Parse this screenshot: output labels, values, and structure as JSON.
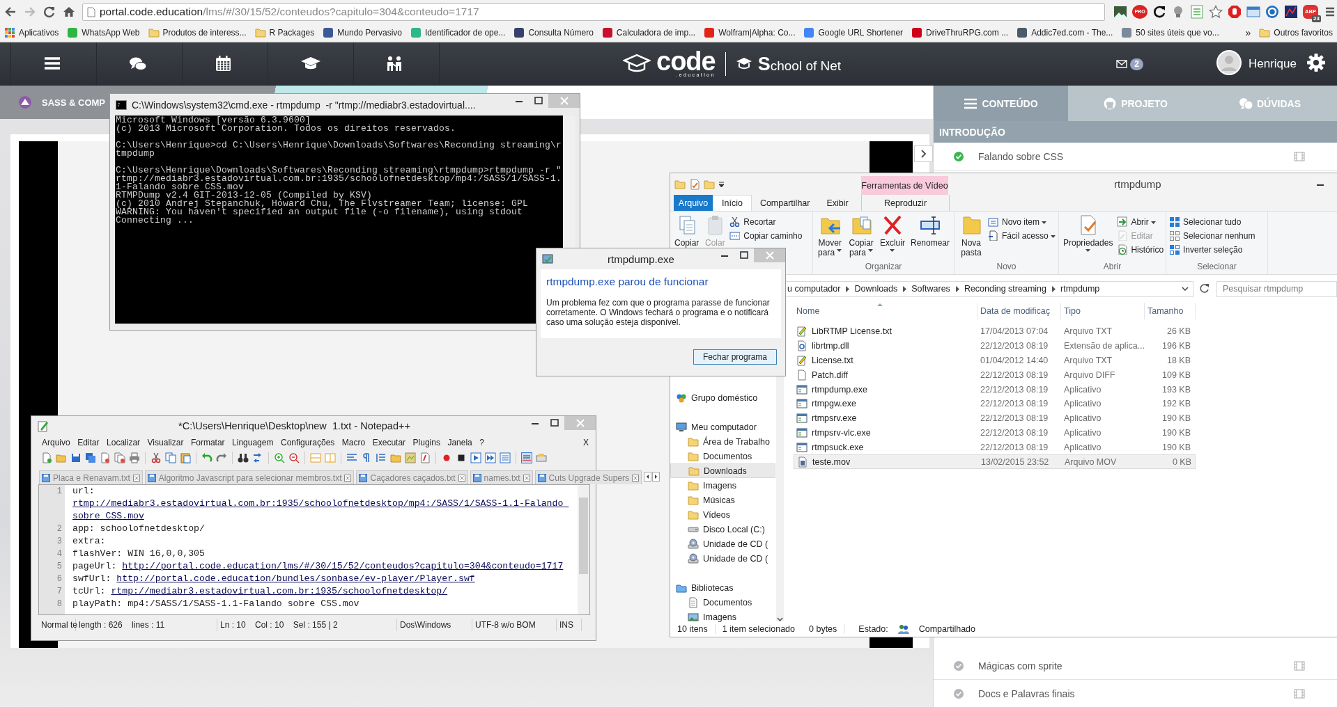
{
  "browser": {
    "url_host": "portal.code.education",
    "url_path": "/lms/#/30/15/52/conteudos?capitulo=304&conteudo=1717",
    "extensions": [
      {
        "kind": "photo"
      },
      {
        "kind": "pro",
        "label": "PRO"
      },
      {
        "kind": "reload"
      },
      {
        "kind": "bulb"
      },
      {
        "kind": "list"
      },
      {
        "kind": "star"
      },
      {
        "kind": "stop"
      },
      {
        "kind": "window"
      },
      {
        "kind": "ring"
      },
      {
        "kind": "chart"
      },
      {
        "kind": "abp",
        "label": "ABP",
        "count": "23"
      },
      {
        "kind": "menu"
      }
    ],
    "bookmarks": [
      {
        "kind": "apps",
        "label": "Aplicativos"
      },
      {
        "kind": "site",
        "color": "#2fb544",
        "label": "WhatsApp Web"
      },
      {
        "kind": "folder",
        "label": "Produtos de interess..."
      },
      {
        "kind": "folder",
        "label": "R Packages"
      },
      {
        "kind": "site",
        "color": "#3b5998",
        "label": "Mundo Pervasivo"
      },
      {
        "kind": "site",
        "color": "#2eb88a",
        "label": "Identificador de ope..."
      },
      {
        "kind": "site",
        "color": "#35406b",
        "label": "Consulta Número"
      },
      {
        "kind": "site",
        "color": "#c8102e",
        "label": "Calculadora de imp..."
      },
      {
        "kind": "site",
        "color": "#e2231a",
        "label": "Wolfram|Alpha: Co..."
      },
      {
        "kind": "site",
        "color": "#4285f4",
        "label": "Google URL Shortener"
      },
      {
        "kind": "site",
        "color": "#d0021b",
        "label": "DriveThruRPG.com ..."
      },
      {
        "kind": "site",
        "color": "#4a5a6a",
        "label": "Addic7ed.com - The..."
      },
      {
        "kind": "site",
        "color": "#7a8a9a",
        "label": "50 sites úteis que vo..."
      }
    ],
    "more": "»",
    "other_bookmarks": "Outros favoritos"
  },
  "site": {
    "logo": "code",
    "logo_tagline": ".education",
    "partner": "School of Net",
    "messages": "2",
    "user": "Henrique",
    "course": "SASS & COMP",
    "tabs": [
      {
        "label": "CONTEÚDO",
        "selected": true
      },
      {
        "label": "PROJETO",
        "selected": false
      },
      {
        "label": "DÚVIDAS",
        "selected": false
      }
    ],
    "section": "INTRODUÇÃO",
    "lessons_top": [
      {
        "title": "Falando sobre CSS",
        "completed": true
      }
    ],
    "lessons_bottom": [
      {
        "title": "Mágicas com sprite",
        "completed": false
      },
      {
        "title": "Docs e Palavras finais",
        "completed": false
      }
    ]
  },
  "cmd": {
    "title": "C:\\Windows\\system32\\cmd.exe - rtmpdump  -r \"rtmp://mediabr3.estadovirtual....",
    "blocks": [
      [
        "Microsoft Windows [versão 6.3.9600]",
        "(c) 2013 Microsoft Corporation. Todos os direitos reservados."
      ],
      [
        "C:\\Users\\Henrique>cd C:\\Users\\Henrique\\Downloads\\Softwares\\Reconding streaming\\r",
        "tmpdump"
      ],
      [
        "C:\\Users\\Henrique\\Downloads\\Softwares\\Reconding streaming\\rtmpdump>rtmpdump -r \"",
        "rtmp://mediabr3.estadovirtual.com.br:1935/schoolofnetdesktop/mp4:/SASS/1/SASS-1.",
        "1-Falando sobre CSS.mov",
        "RTMPDump v2.4 GIT-2013-12-05 (Compiled by KSV)",
        "(c) 2010 Andrej Stepanchuk, Howard Chu, The Flvstreamer Team; license: GPL",
        "WARNING: You haven't specified an output file (-o filename), using stdout",
        "Connecting ..."
      ]
    ]
  },
  "dialog": {
    "title": "rtmpdump.exe",
    "heading": "rtmpdump.exe parou de funcionar",
    "message": "Um problema fez com que o programa parasse de funcionar corretamente. O Windows fechará o programa e o notificará caso uma solução esteja disponível.",
    "button": "Fechar programa"
  },
  "explorer": {
    "title": "rtmpdump",
    "context_header": "Ferramentas de Vídeo",
    "tabs": [
      {
        "label": "Arquivo",
        "kind": "file",
        "selected": false
      },
      {
        "label": "Início",
        "kind": "tab",
        "selected": true
      },
      {
        "label": "Compartilhar",
        "kind": "tab",
        "selected": false
      },
      {
        "label": "Exibir",
        "kind": "tab",
        "selected": false
      },
      {
        "label": "Reproduzir",
        "kind": "context",
        "selected": false
      }
    ],
    "ribbon": [
      {
        "items": [
          {
            "kind": "large",
            "label": "Copiar",
            "dropdown": false,
            "disabled": false
          },
          {
            "kind": "large",
            "label": "Colar",
            "dropdown": false,
            "disabled": true
          },
          {
            "kind": "stack",
            "items": [
              {
                "label": "Recortar",
                "dropdown": false,
                "disabled": false
              },
              {
                "label": "Copiar caminho",
                "dropdown": false,
                "disabled": false
              }
            ]
          }
        ]
      },
      {
        "label": "Organizar",
        "items": [
          {
            "kind": "large",
            "label": "Mover para",
            "dropdown": true,
            "disabled": false
          },
          {
            "kind": "large",
            "label": "Copiar para",
            "dropdown": true,
            "disabled": false
          },
          {
            "kind": "large",
            "label": "Excluir",
            "dropdown": true,
            "disabled": false
          },
          {
            "kind": "large",
            "label": "Renomear",
            "dropdown": false,
            "disabled": false
          }
        ]
      },
      {
        "label": "Novo",
        "items": [
          {
            "kind": "large",
            "label": "Nova pasta",
            "dropdown": false,
            "disabled": false
          },
          {
            "kind": "stack",
            "items": [
              {
                "label": "Novo item",
                "dropdown": true,
                "disabled": false
              },
              {
                "label": "Fácil acesso",
                "dropdown": true,
                "disabled": false
              }
            ]
          }
        ]
      },
      {
        "label": "Abrir",
        "items": [
          {
            "kind": "large",
            "label": "Propriedades",
            "dropdown": true,
            "disabled": false
          },
          {
            "kind": "stack",
            "items": [
              {
                "label": "Abrir",
                "dropdown": true,
                "disabled": false
              },
              {
                "label": "Editar",
                "dropdown": false,
                "disabled": true
              },
              {
                "label": "Histórico",
                "dropdown": false,
                "disabled": false
              }
            ]
          }
        ]
      },
      {
        "label": "Selecionar",
        "items": [
          {
            "kind": "stack",
            "items": [
              {
                "label": "Selecionar tudo",
                "dropdown": false,
                "disabled": false
              },
              {
                "label": "Selecionar nenhum",
                "dropdown": false,
                "disabled": false
              },
              {
                "label": "Inverter seleção",
                "dropdown": false,
                "disabled": false
              }
            ]
          }
        ]
      }
    ],
    "breadcrumb": [
      "u computador",
      "Downloads",
      "Softwares",
      "Reconding streaming",
      "rtmpdump"
    ],
    "search_placeholder": "Pesquisar rtmpdump",
    "nav": [
      {
        "kind": "homegroup",
        "label": "Grupo doméstico",
        "selected": false
      },
      {
        "kind": "computer",
        "label": "Meu computador",
        "selected": false,
        "children": [
          {
            "kind": "folder",
            "label": "Área de Trabalho",
            "selected": false
          },
          {
            "kind": "folder",
            "label": "Documentos",
            "selected": false
          },
          {
            "kind": "folder",
            "label": "Downloads",
            "selected": true
          },
          {
            "kind": "folder",
            "label": "Imagens",
            "selected": false
          },
          {
            "kind": "folder",
            "label": "Músicas",
            "selected": false
          },
          {
            "kind": "folder",
            "label": "Vídeos",
            "selected": false
          },
          {
            "kind": "drive",
            "label": "Disco Local (C:)",
            "selected": false
          },
          {
            "kind": "cd",
            "label": "Unidade de CD (",
            "selected": false
          },
          {
            "kind": "cd",
            "label": "Unidade de CD (",
            "selected": false
          }
        ]
      },
      {
        "kind": "library",
        "label": "Bibliotecas",
        "selected": false,
        "children": [
          {
            "kind": "document",
            "label": "Documentos",
            "selected": false
          },
          {
            "kind": "picture",
            "label": "Imagens",
            "selected": false
          }
        ]
      }
    ],
    "columns": [
      "Nome",
      "Data de modificaç",
      "Tipo",
      "Tamanho"
    ],
    "files": [
      {
        "kind": "text",
        "name": "LibRTMP License.txt",
        "date": "17/04/2013 07:04",
        "type": "Arquivo TXT",
        "size": "26 KB",
        "selected": false
      },
      {
        "kind": "library",
        "name": "librtmp.dll",
        "date": "22/12/2013 08:19",
        "type": "Extensão de aplica...",
        "size": "196 KB",
        "selected": false
      },
      {
        "kind": "text",
        "name": "License.txt",
        "date": "01/04/2012 14:40",
        "type": "Arquivo TXT",
        "size": "18 KB",
        "selected": false
      },
      {
        "kind": "plain",
        "name": "Patch.diff",
        "date": "22/12/2013 08:19",
        "type": "Arquivo DIFF",
        "size": "109 KB",
        "selected": false
      },
      {
        "kind": "program",
        "name": "rtmpdump.exe",
        "date": "22/12/2013 08:19",
        "type": "Aplicativo",
        "size": "193 KB",
        "selected": false
      },
      {
        "kind": "program",
        "name": "rtmpgw.exe",
        "date": "22/12/2013 08:19",
        "type": "Aplicativo",
        "size": "192 KB",
        "selected": false
      },
      {
        "kind": "program",
        "name": "rtmpsrv.exe",
        "date": "22/12/2013 08:19",
        "type": "Aplicativo",
        "size": "190 KB",
        "selected": false
      },
      {
        "kind": "program",
        "name": "rtmpsrv-vlc.exe",
        "date": "22/12/2013 08:19",
        "type": "Aplicativo",
        "size": "190 KB",
        "selected": false
      },
      {
        "kind": "program",
        "name": "rtmpsuck.exe",
        "date": "22/12/2013 08:19",
        "type": "Aplicativo",
        "size": "190 KB",
        "selected": false
      },
      {
        "kind": "movie",
        "name": "teste.mov",
        "date": "13/02/2015 23:52",
        "type": "Arquivo MOV",
        "size": "0 KB",
        "selected": true
      }
    ],
    "status": {
      "count": "10 itens",
      "selection": "1 item selecionado",
      "selection_size": "0 bytes",
      "state_label": "Estado:",
      "state": "Compartilhado"
    }
  },
  "notepad": {
    "title": "*C:\\Users\\Henrique\\Desktop\\new  1.txt - Notepad++",
    "menu": [
      "Arquivo",
      "Editar",
      "Localizar",
      "Visualizar",
      "Formatar",
      "Linguagem",
      "Configurações",
      "Macro",
      "Executar",
      "Plugins",
      "Janela",
      "?"
    ],
    "close_document": "X",
    "tabs": [
      "Placa e Renavam.txt",
      "Algoritmo Javascript para selecionar membros.txt",
      "Caçadores caçados.txt",
      "names.txt",
      "Cuts Upgrade Supers"
    ],
    "lines": [
      {
        "number": "1",
        "key": "url:",
        "value": "rtmp://mediabr3.estadovirtual.com.br:1935/schoolofnetdesktop/mp4:/SASS/1/SASS-1.1-Falando sobre CSS.mov",
        "link": true
      },
      {
        "number": "2",
        "key": "app:",
        "value": "schoolofnetdesktop/",
        "link": false
      },
      {
        "number": "3",
        "key": "extra:"
      },
      {
        "number": "4",
        "key": "flashVer:",
        "value": "WIN 16,0,0,305",
        "link": false
      },
      {
        "number": "5",
        "key": "pageUrl:",
        "value": "http://portal.code.education/lms/#/30/15/52/conteudos?capitulo=304&conteudo=1717",
        "link": true
      },
      {
        "number": "6",
        "key": "swfUrl:",
        "value": "http://portal.code.education/bundles/sonbase/ev-player/Player.swf",
        "link": true
      },
      {
        "number": "7",
        "key": "tcUrl:",
        "value": "rtmp://mediabr3.estadovirtual.com.br:1935/schoolofnetdesktop/",
        "link": true
      },
      {
        "number": "8",
        "key": "playPath:",
        "value": "mp4:/SASS/1/SASS-1.1-Falando sobre CSS.mov",
        "link": false
      }
    ],
    "status": {
      "mode": "Normal te",
      "stats": "length : 626    lines : 11",
      "position": "Ln : 10    Col : 10    Sel : 155 | 2",
      "eol": "Dos\\Windows",
      "encoding": "UTF-8 w/o BOM",
      "insert": "INS"
    }
  }
}
